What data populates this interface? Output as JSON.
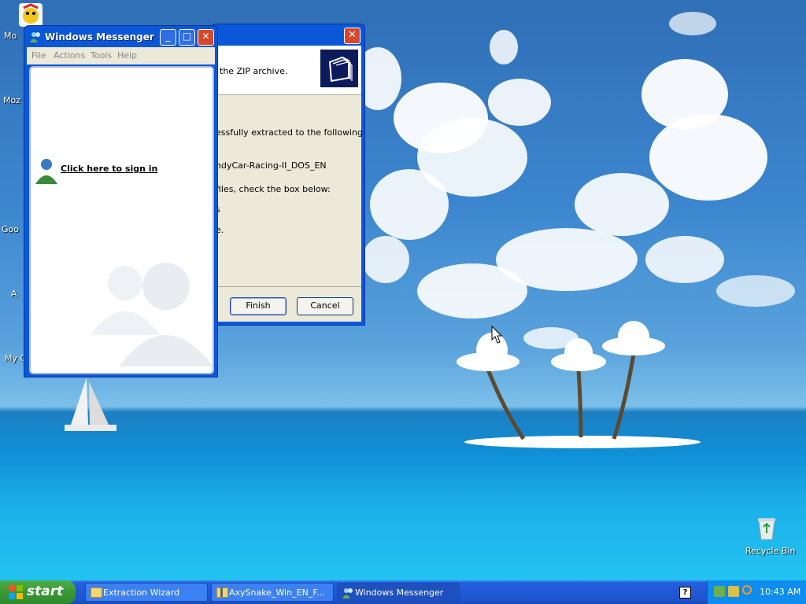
{
  "desktop": {
    "icons_left": [
      "Mo",
      "Moz",
      "Goo",
      "A",
      "My C"
    ],
    "recycle_bin": "Recycle Bin"
  },
  "wizard": {
    "header_text": "the ZIP archive.",
    "line1": "essfully extracted to the following",
    "line2": "ndyCar-Racing-II_DOS_EN",
    "line3": "files, check the box below:",
    "line4": "s",
    "line5": "e.",
    "finish": "Finish",
    "cancel": "Cancel"
  },
  "messenger": {
    "title": "Windows Messenger",
    "menu": [
      "File",
      "Actions",
      "Tools",
      "Help"
    ],
    "signin": "Click here to sign in"
  },
  "taskbar": {
    "start": "start",
    "tasks": [
      {
        "label": "Extraction Wizard",
        "icon": "folder-icon"
      },
      {
        "label": "AxySnake_Win_EN_F...",
        "icon": "zip-folder-icon"
      },
      {
        "label": "Windows Messenger",
        "icon": "messenger-icon"
      }
    ],
    "clock": "10:43 AM"
  }
}
